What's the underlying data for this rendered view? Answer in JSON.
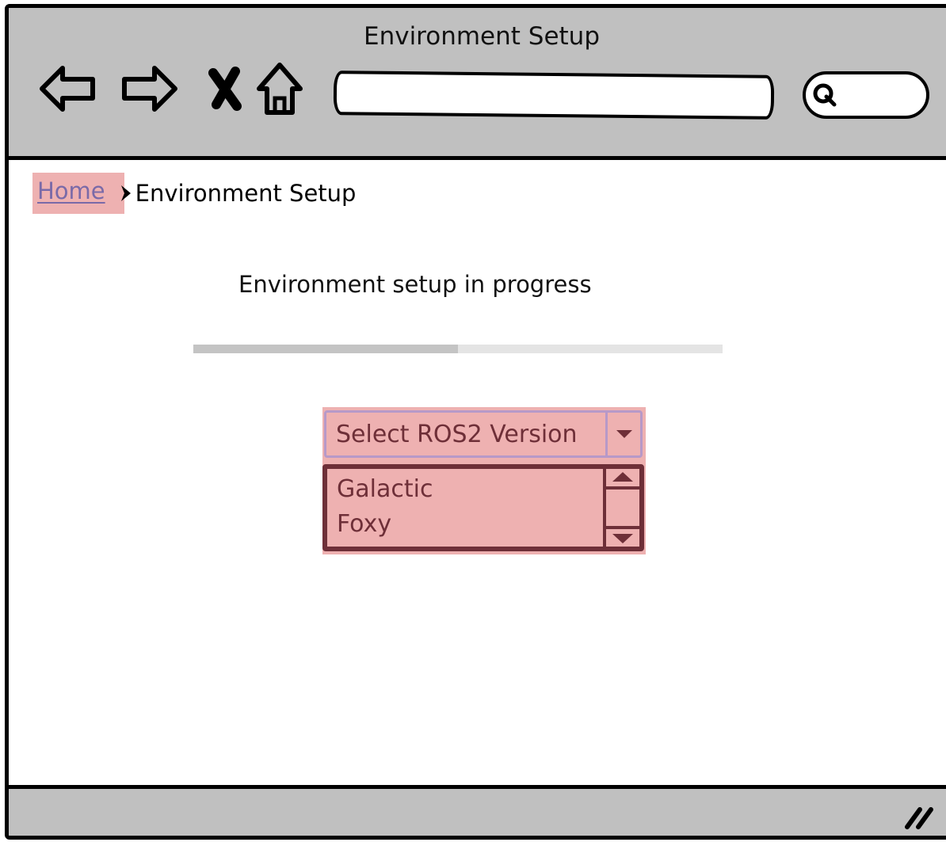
{
  "window": {
    "title": "Environment Setup"
  },
  "toolbar": {
    "icons": [
      "back-arrow-icon",
      "forward-arrow-icon",
      "close-x-icon",
      "home-icon",
      "search-icon"
    ],
    "url_value": ""
  },
  "breadcrumb": {
    "home_label": "Home",
    "separator_icon": "chevron-right-icon",
    "current_label": "Environment Setup"
  },
  "main": {
    "status_text": "Environment setup in progress",
    "progress_fraction": 0.5
  },
  "dropdown": {
    "selected_label": "Select ROS2 Version",
    "options": [
      "Galactic",
      "Foxy"
    ]
  },
  "colors": {
    "chrome": "#c0c0c0",
    "highlight": "#eeb1b1",
    "dropdown_text": "#6e2f38",
    "link": "#7a6aa8"
  }
}
